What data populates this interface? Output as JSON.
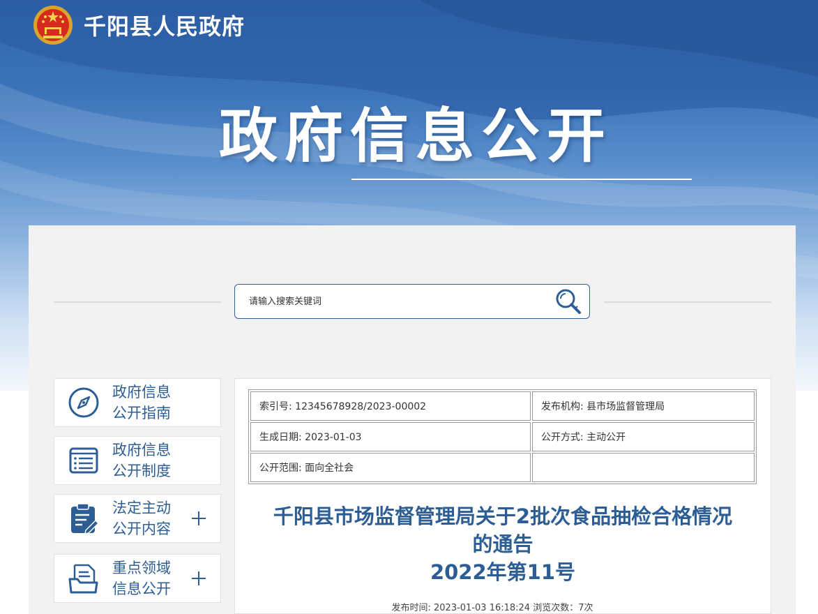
{
  "header": {
    "site_name": "千阳县人民政府"
  },
  "banner": {
    "title": "政府信息公开"
  },
  "search": {
    "placeholder": "请输入搜索关键词"
  },
  "sidebar": {
    "items": [
      {
        "label_line1": "政府信息",
        "label_line2": "公开指南",
        "icon": "compass-icon",
        "expandable": false
      },
      {
        "label_line1": "政府信息",
        "label_line2": "公开制度",
        "icon": "list-document-icon",
        "expandable": false
      },
      {
        "label_line1": "法定主动",
        "label_line2": "公开内容",
        "icon": "clipboard-edit-icon",
        "expandable": true
      },
      {
        "label_line1": "重点领域",
        "label_line2": "信息公开",
        "icon": "folder-document-icon",
        "expandable": true
      }
    ]
  },
  "meta": {
    "index_no": "索引号: 12345678928/2023-00002",
    "publisher": "发布机构: 县市场监督管理局",
    "created_date": "生成日期: 2023-01-03",
    "disclosure_method": "公开方式: 主动公开",
    "disclosure_scope": "公开范围: 面向全社会",
    "empty": ""
  },
  "article": {
    "title_line1": "千阳县市场监督管理局关于2批次食品抽检合格情况",
    "title_line2": "的通告",
    "title_line3": "2022年第11号",
    "publish_info": "发布时间: 2023-01-03 16:18:24 浏览次数：7次"
  },
  "colors": {
    "primary_blue": "#2c5d94",
    "banner_blue": "#2f63aa",
    "panel_gray": "#f2f2f2"
  }
}
